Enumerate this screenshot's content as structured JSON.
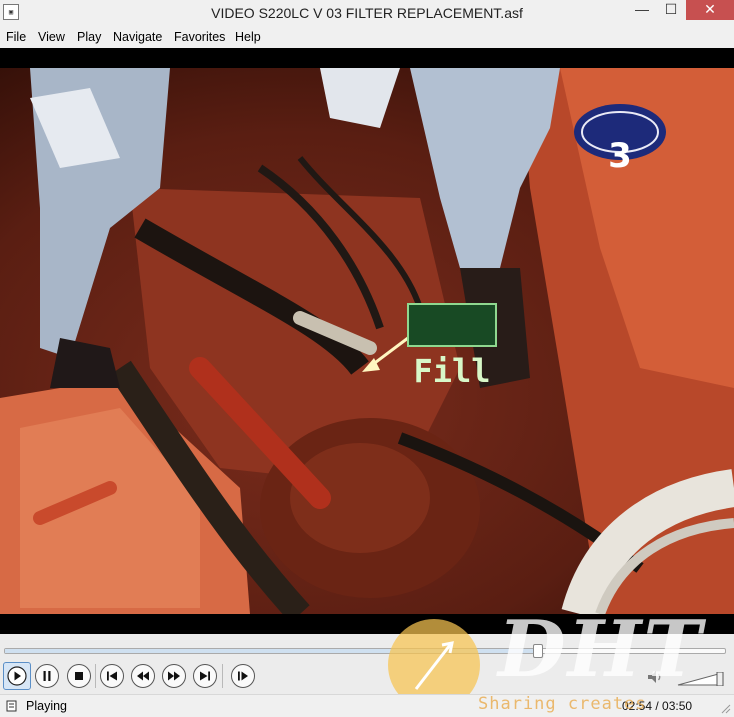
{
  "window": {
    "title": "VIDEO S220LC V 03 FILTER REPLACEMENT.asf",
    "icon": "media-player-icon",
    "controls": {
      "minimize": "—",
      "maximize": "☐",
      "close": "✕"
    }
  },
  "menu": {
    "items": [
      {
        "label": "File"
      },
      {
        "label": "View"
      },
      {
        "label": "Play"
      },
      {
        "label": "Navigate"
      },
      {
        "label": "Favorites"
      },
      {
        "label": "Help"
      }
    ]
  },
  "video": {
    "channel_badge": "3",
    "overlay_caption": "Fill"
  },
  "playback": {
    "progress_fraction": 0.74,
    "buttons": [
      {
        "name": "play-button",
        "icon": "play-icon"
      },
      {
        "name": "pause-button",
        "icon": "pause-icon"
      },
      {
        "name": "stop-button",
        "icon": "stop-icon"
      },
      {
        "name": "previous-button",
        "icon": "skip-back-icon"
      },
      {
        "name": "rewind-button",
        "icon": "rewind-icon"
      },
      {
        "name": "fast-forward-button",
        "icon": "fast-forward-icon"
      },
      {
        "name": "next-button",
        "icon": "skip-forward-icon"
      },
      {
        "name": "frame-step-button",
        "icon": "frame-step-icon"
      }
    ],
    "volume_icon": "speaker-icon"
  },
  "status": {
    "state": "Playing",
    "time": "02:54 / 03:50"
  },
  "watermark": {
    "logo": "DHT",
    "slogan": "Sharing creates success"
  }
}
